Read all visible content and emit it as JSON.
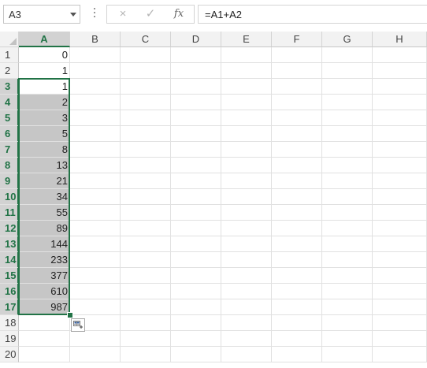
{
  "formula_bar": {
    "name_box": "A3",
    "cancel_icon": "×",
    "enter_icon": "✓",
    "function_icon": "fx",
    "formula": "=A1+A2"
  },
  "columns": [
    "A",
    "B",
    "C",
    "D",
    "E",
    "F",
    "G",
    "H"
  ],
  "rows": [
    "1",
    "2",
    "3",
    "4",
    "5",
    "6",
    "7",
    "8",
    "9",
    "10",
    "11",
    "12",
    "13",
    "14",
    "15",
    "16",
    "17",
    "18",
    "19",
    "20"
  ],
  "column_a_values": [
    "0",
    "1",
    "1",
    "2",
    "3",
    "5",
    "8",
    "13",
    "21",
    "34",
    "55",
    "89",
    "144",
    "233",
    "377",
    "610",
    "987",
    "",
    "",
    ""
  ],
  "selection": {
    "column": "A",
    "first_row": "3",
    "last_row": "17"
  },
  "colors": {
    "accent": "#217346",
    "selected_fill": "#c6c6c6",
    "header_bg": "#f2f2f2"
  }
}
